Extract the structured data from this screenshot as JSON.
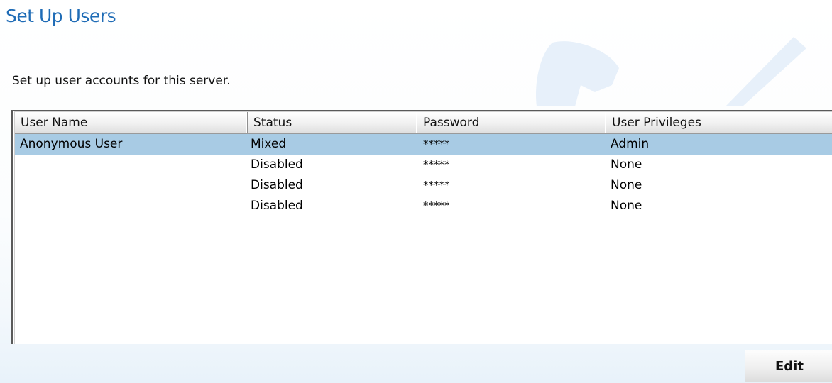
{
  "page": {
    "title": "Set Up Users",
    "description": "Set up user accounts for this server."
  },
  "table": {
    "columns": [
      "User Name",
      "Status",
      "Password",
      "User Privileges"
    ],
    "rows": [
      {
        "user_name": "Anonymous User",
        "status": "Mixed",
        "password": "*****",
        "privileges": "Admin",
        "selected": true
      },
      {
        "user_name": "",
        "status": "Disabled",
        "password": "*****",
        "privileges": "None",
        "selected": false
      },
      {
        "user_name": "",
        "status": "Disabled",
        "password": "*****",
        "privileges": "None",
        "selected": false
      },
      {
        "user_name": "",
        "status": "Disabled",
        "password": "*****",
        "privileges": "None",
        "selected": false
      }
    ]
  },
  "actions": {
    "edit_label": "Edit"
  },
  "colors": {
    "title": "#1f6cb6",
    "selected_row": "#a8cbe4",
    "background_art": "#e7f0fa"
  },
  "icons": {
    "background": "wrench-screwdriver-watermark"
  }
}
